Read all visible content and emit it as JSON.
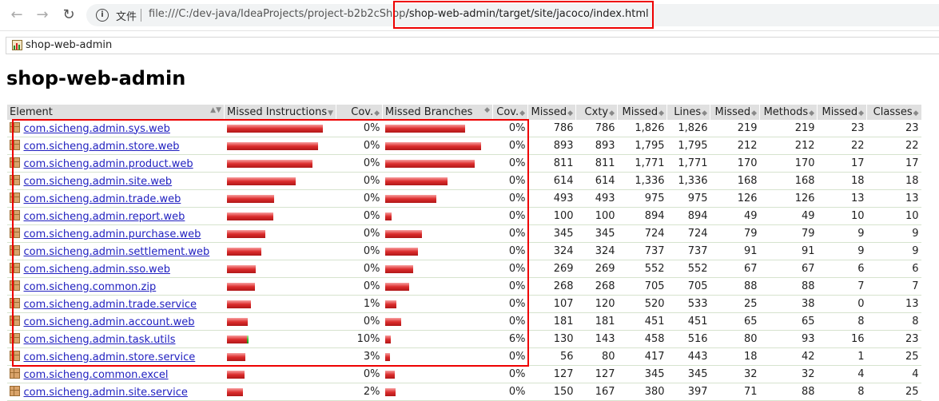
{
  "browser": {
    "back_icon": "arrow-left-icon",
    "forward_icon": "arrow-right-icon",
    "reload_icon": "reload-icon",
    "file_label": "文件",
    "url_prefix": "file:///C:/dev-java/IdeaProjects/project-b2b2cShop",
    "url_suffix": "/shop-web-admin/target/site/jacoco/index.html"
  },
  "breadcrumb": {
    "label": "shop-web-admin"
  },
  "page": {
    "title": "shop-web-admin"
  },
  "table": {
    "headers": {
      "element": "Element",
      "missed_instructions": "Missed Instructions",
      "cov1": "Cov.",
      "missed_branches": "Missed Branches",
      "cov2": "Cov.",
      "missed_cxty": "Missed",
      "cxty": "Cxty",
      "missed_lines": "Missed",
      "lines": "Lines",
      "missed_methods": "Missed",
      "methods": "Methods",
      "missed_classes": "Missed",
      "classes": "Classes"
    },
    "rows": [
      {
        "name": "com.sicheng.admin.sys.web",
        "instr_red": 1.0,
        "instr_green": 0,
        "cov": "0%",
        "branch_red": 0.83,
        "branch_green": 0,
        "bcov": "0%",
        "mcx": "786",
        "cx": "786",
        "ml": "1,826",
        "l": "1,826",
        "mm": "219",
        "m": "219",
        "mc": "23",
        "c": "23"
      },
      {
        "name": "com.sicheng.admin.store.web",
        "instr_red": 0.95,
        "instr_green": 0,
        "cov": "0%",
        "branch_red": 1.0,
        "branch_green": 0,
        "bcov": "0%",
        "mcx": "893",
        "cx": "893",
        "ml": "1,795",
        "l": "1,795",
        "mm": "212",
        "m": "212",
        "mc": "22",
        "c": "22"
      },
      {
        "name": "com.sicheng.admin.product.web",
        "instr_red": 0.89,
        "instr_green": 0,
        "cov": "0%",
        "branch_red": 0.93,
        "branch_green": 0,
        "bcov": "0%",
        "mcx": "811",
        "cx": "811",
        "ml": "1,771",
        "l": "1,771",
        "mm": "170",
        "m": "170",
        "mc": "17",
        "c": "17"
      },
      {
        "name": "com.sicheng.admin.site.web",
        "instr_red": 0.72,
        "instr_green": 0,
        "cov": "0%",
        "branch_red": 0.65,
        "branch_green": 0,
        "bcov": "0%",
        "mcx": "614",
        "cx": "614",
        "ml": "1,336",
        "l": "1,336",
        "mm": "168",
        "m": "168",
        "mc": "18",
        "c": "18"
      },
      {
        "name": "com.sicheng.admin.trade.web",
        "instr_red": 0.49,
        "instr_green": 0,
        "cov": "0%",
        "branch_red": 0.53,
        "branch_green": 0,
        "bcov": "0%",
        "mcx": "493",
        "cx": "493",
        "ml": "975",
        "l": "975",
        "mm": "126",
        "m": "126",
        "mc": "13",
        "c": "13"
      },
      {
        "name": "com.sicheng.admin.report.web",
        "instr_red": 0.48,
        "instr_green": 0,
        "cov": "0%",
        "branch_red": 0.07,
        "branch_green": 0,
        "bcov": "0%",
        "mcx": "100",
        "cx": "100",
        "ml": "894",
        "l": "894",
        "mm": "49",
        "m": "49",
        "mc": "10",
        "c": "10"
      },
      {
        "name": "com.sicheng.admin.purchase.web",
        "instr_red": 0.4,
        "instr_green": 0,
        "cov": "0%",
        "branch_red": 0.38,
        "branch_green": 0,
        "bcov": "0%",
        "mcx": "345",
        "cx": "345",
        "ml": "724",
        "l": "724",
        "mm": "79",
        "m": "79",
        "mc": "9",
        "c": "9"
      },
      {
        "name": "com.sicheng.admin.settlement.web",
        "instr_red": 0.36,
        "instr_green": 0,
        "cov": "0%",
        "branch_red": 0.34,
        "branch_green": 0,
        "bcov": "0%",
        "mcx": "324",
        "cx": "324",
        "ml": "737",
        "l": "737",
        "mm": "91",
        "m": "91",
        "mc": "9",
        "c": "9"
      },
      {
        "name": "com.sicheng.admin.sso.web",
        "instr_red": 0.3,
        "instr_green": 0,
        "cov": "0%",
        "branch_red": 0.29,
        "branch_green": 0,
        "bcov": "0%",
        "mcx": "269",
        "cx": "269",
        "ml": "552",
        "l": "552",
        "mm": "67",
        "m": "67",
        "mc": "6",
        "c": "6"
      },
      {
        "name": "com.sicheng.common.zip",
        "instr_red": 0.29,
        "instr_green": 0,
        "cov": "0%",
        "branch_red": 0.25,
        "branch_green": 0,
        "bcov": "0%",
        "mcx": "268",
        "cx": "268",
        "ml": "705",
        "l": "705",
        "mm": "88",
        "m": "88",
        "mc": "7",
        "c": "7"
      },
      {
        "name": "com.sicheng.admin.trade.service",
        "instr_red": 0.25,
        "instr_green": 0,
        "cov": "1%",
        "branch_red": 0.12,
        "branch_green": 0,
        "bcov": "0%",
        "mcx": "107",
        "cx": "120",
        "ml": "520",
        "l": "533",
        "mm": "25",
        "m": "38",
        "mc": "0",
        "c": "13"
      },
      {
        "name": "com.sicheng.admin.account.web",
        "instr_red": 0.22,
        "instr_green": 0,
        "cov": "0%",
        "branch_red": 0.17,
        "branch_green": 0,
        "bcov": "0%",
        "mcx": "181",
        "cx": "181",
        "ml": "451",
        "l": "451",
        "mm": "65",
        "m": "65",
        "mc": "8",
        "c": "8"
      },
      {
        "name": "com.sicheng.admin.task.utils",
        "instr_red": 0.21,
        "instr_green": 0.02,
        "cov": "10%",
        "branch_red": 0.06,
        "branch_green": 0,
        "bcov": "6%",
        "mcx": "130",
        "cx": "143",
        "ml": "458",
        "l": "516",
        "mm": "80",
        "m": "93",
        "mc": "16",
        "c": "23"
      },
      {
        "name": "com.sicheng.admin.store.service",
        "instr_red": 0.19,
        "instr_green": 0,
        "cov": "3%",
        "branch_red": 0.05,
        "branch_green": 0,
        "bcov": "0%",
        "mcx": "56",
        "cx": "80",
        "ml": "417",
        "l": "443",
        "mm": "18",
        "m": "42",
        "mc": "1",
        "c": "25"
      },
      {
        "name": "com.sicheng.common.excel",
        "instr_red": 0.18,
        "instr_green": 0,
        "cov": "0%",
        "branch_red": 0.1,
        "branch_green": 0,
        "bcov": "0%",
        "mcx": "127",
        "cx": "127",
        "ml": "345",
        "l": "345",
        "mm": "32",
        "m": "32",
        "mc": "4",
        "c": "4"
      },
      {
        "name": "com.sicheng.admin.site.service",
        "instr_red": 0.17,
        "instr_green": 0,
        "cov": "2%",
        "branch_red": 0.11,
        "branch_green": 0,
        "bcov": "0%",
        "mcx": "150",
        "cx": "167",
        "ml": "380",
        "l": "397",
        "mm": "71",
        "m": "88",
        "mc": "8",
        "c": "25"
      }
    ]
  }
}
